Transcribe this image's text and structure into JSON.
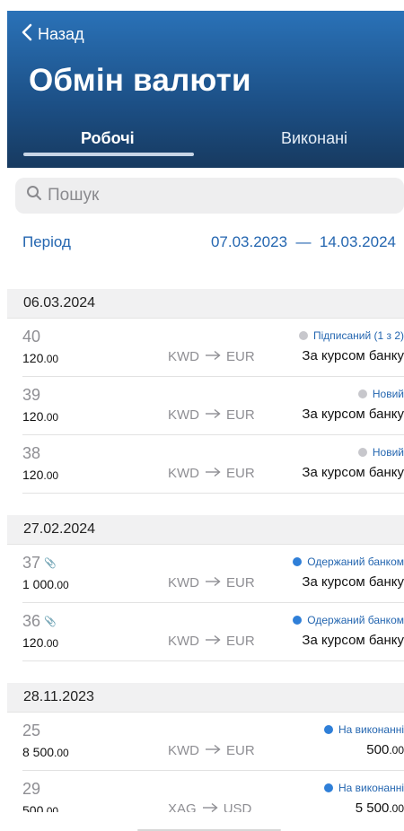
{
  "nav": {
    "back_label": "Назад",
    "title": "Обмін валюти"
  },
  "tabs": [
    {
      "label": "Робочі",
      "active": true
    },
    {
      "label": "Виконані",
      "active": false
    }
  ],
  "search": {
    "placeholder": "Пошук"
  },
  "period": {
    "label": "Період",
    "range": "07.03.2023  —  14.03.2024"
  },
  "colors": {
    "accent": "#2466b0",
    "status_grey": "#c7c7cc",
    "status_blue": "#2f7fd8"
  },
  "groups": [
    {
      "date": "06.03.2024",
      "rows": [
        {
          "number": "40",
          "attachment": false,
          "status": "Підписаний (1 з 2)",
          "status_color": "grey",
          "amount_int": "120",
          "amount_dec": ".00",
          "from": "KWD",
          "to": "EUR",
          "rate": "За курсом банку"
        },
        {
          "number": "39",
          "attachment": false,
          "status": "Новий",
          "status_color": "grey",
          "amount_int": "120",
          "amount_dec": ".00",
          "from": "KWD",
          "to": "EUR",
          "rate": "За курсом банку"
        },
        {
          "number": "38",
          "attachment": false,
          "status": "Новий",
          "status_color": "grey",
          "amount_int": "120",
          "amount_dec": ".00",
          "from": "KWD",
          "to": "EUR",
          "rate": "За курсом банку"
        }
      ]
    },
    {
      "date": "27.02.2024",
      "rows": [
        {
          "number": "37",
          "attachment": true,
          "status": "Одержаний банком",
          "status_color": "blue",
          "amount_int": "1 000",
          "amount_dec": ".00",
          "from": "KWD",
          "to": "EUR",
          "rate": "За курсом банку"
        },
        {
          "number": "36",
          "attachment": true,
          "status": "Одержаний банком",
          "status_color": "blue",
          "amount_int": "120",
          "amount_dec": ".00",
          "from": "KWD",
          "to": "EUR",
          "rate": "За курсом банку"
        }
      ]
    },
    {
      "date": "28.11.2023",
      "rows": [
        {
          "number": "25",
          "attachment": false,
          "status": "На виконанні",
          "status_color": "blue",
          "amount_int": "8 500",
          "amount_dec": ".00",
          "from": "KWD",
          "to": "EUR",
          "rate": "500.00"
        },
        {
          "number": "29",
          "attachment": false,
          "status": "На виконанні",
          "status_color": "blue",
          "amount_int": "500",
          "amount_dec": ".00",
          "from": "XAG",
          "to": "USD",
          "rate": "5 500.00"
        }
      ]
    }
  ]
}
